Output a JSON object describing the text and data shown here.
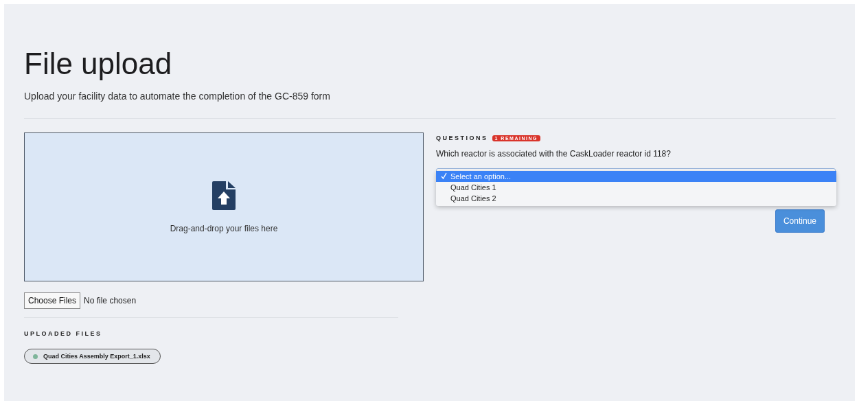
{
  "header": {
    "title": "File upload",
    "subtitle": "Upload your facility data to automate the completion of the GC-859 form"
  },
  "upload": {
    "dropzone_text": "Drag-and-drop your files here",
    "choose_button": "Choose Files",
    "file_status": "No file chosen"
  },
  "uploaded": {
    "heading": "UPLOADED FILES",
    "files": [
      {
        "name": "Quad Cities Assembly Export_1.xlsx",
        "color": "#7fb59a"
      }
    ]
  },
  "questions": {
    "heading": "QUESTIONS",
    "badge": "1 REMAINING",
    "question": "Which reactor is associated with the CaskLoader reactor id 118?",
    "dropdown_open": true,
    "options": [
      {
        "label": "Select an option...",
        "selected": true
      },
      {
        "label": "Quad Cities 1",
        "selected": false
      },
      {
        "label": "Quad Cities 2",
        "selected": false
      }
    ],
    "continue_button": "Continue"
  }
}
